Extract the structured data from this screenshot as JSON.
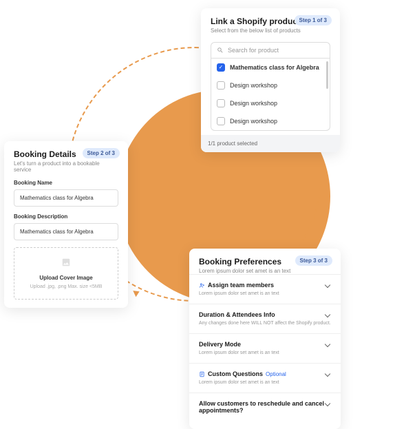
{
  "accent_color": "#e89a4d",
  "primary_blue": "#2563eb",
  "step1": {
    "title": "Link a Shopify product",
    "subtitle": "Select from the below list of products",
    "badge": "Step 1 of 3",
    "search_placeholder": "Search for product",
    "items": [
      {
        "label": "Mathematics class for Algebra",
        "checked": true
      },
      {
        "label": "Design workshop",
        "checked": false
      },
      {
        "label": "Design workshop",
        "checked": false
      },
      {
        "label": "Design workshop",
        "checked": false
      }
    ],
    "footer": "1/1 product selected"
  },
  "step2": {
    "title": "Booking Details",
    "subtitle": "Let's turn a product into a bookable service",
    "badge": "Step 2 of 3",
    "name_label": "Booking Name",
    "name_value": "Mathematics class for Algebra",
    "desc_label": "Booking Description",
    "desc_value": "Mathematics class for Algebra",
    "upload_label": "Upload Cover Image",
    "upload_hint": "Upload .jpg, .png Max. size <5MB"
  },
  "step3": {
    "title": "Booking Preferences",
    "subtitle": "Lorem ipsum dolor set amet is an text",
    "badge": "Step 3 of 3",
    "rows": [
      {
        "title": "Assign team members",
        "sub": "Lorem ipsum dolor set amet is an text"
      },
      {
        "title": "Duration & Attendees Info",
        "sub": "Any changes done here WILL NOT affect the Shopify product."
      },
      {
        "title": "Delivery Mode",
        "sub": "Lorem ipsum dolor set amet is an text"
      },
      {
        "title": "Custom Questions",
        "optional": "Optional",
        "sub": "Lorem ipsum dolor set amet is an text"
      },
      {
        "title": "Allow customers to reschedule and cancel appointments?"
      }
    ]
  }
}
